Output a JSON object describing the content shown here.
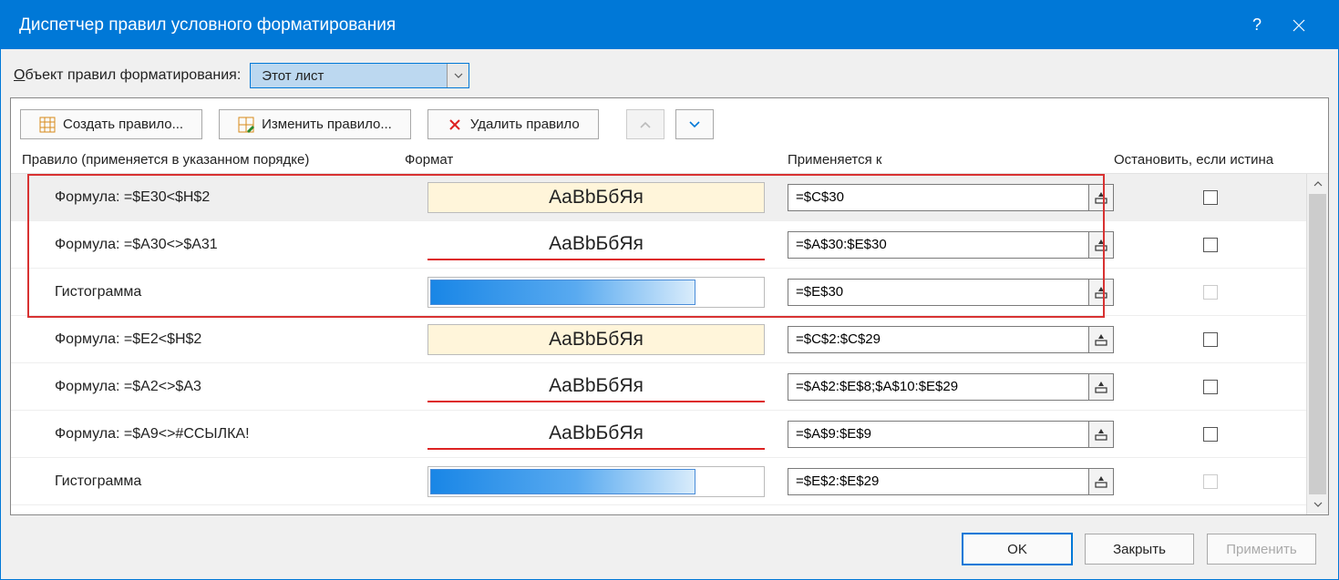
{
  "title": "Диспетчер правил условного форматирования",
  "scope": {
    "label_pre": "О",
    "label_rest": "бъект правил форматирования:",
    "value": "Этот лист"
  },
  "toolbar": {
    "create": "Создать правило...",
    "edit": "Изменить правило...",
    "delete": "Удалить правило"
  },
  "headers": {
    "rule": "Правило (применяется в указанном порядке)",
    "format": "Формат",
    "applies": "Применяется к",
    "stop": "Остановить, если истина"
  },
  "preview_sample": "AaBbБбЯя",
  "rules": [
    {
      "text": "Формула: =$E30<$H$2",
      "style": "yellow",
      "applies": "=$C$30",
      "stop_enabled": true,
      "selected": true
    },
    {
      "text": "Формула: =$A30<>$A31",
      "style": "redline",
      "applies": "=$A$30:$E$30",
      "stop_enabled": true,
      "selected": false
    },
    {
      "text": "Гистограмма",
      "style": "bar",
      "applies": "=$E$30",
      "stop_enabled": false,
      "selected": false
    },
    {
      "text": "Формула: =$E2<$H$2",
      "style": "yellow",
      "applies": "=$C$2:$C$29",
      "stop_enabled": true,
      "selected": false
    },
    {
      "text": "Формула: =$A2<>$A3",
      "style": "redline",
      "applies": "=$A$2:$E$8;$A$10:$E$29",
      "stop_enabled": true,
      "selected": false
    },
    {
      "text": "Формула: =$A9<>#ССЫЛКА!",
      "style": "redline",
      "applies": "=$A$9:$E$9",
      "stop_enabled": true,
      "selected": false
    },
    {
      "text": "Гистограмма",
      "style": "bar",
      "applies": "=$E$2:$E$29",
      "stop_enabled": false,
      "selected": false
    }
  ],
  "footer": {
    "ok": "OK",
    "close": "Закрыть",
    "apply": "Применить"
  }
}
